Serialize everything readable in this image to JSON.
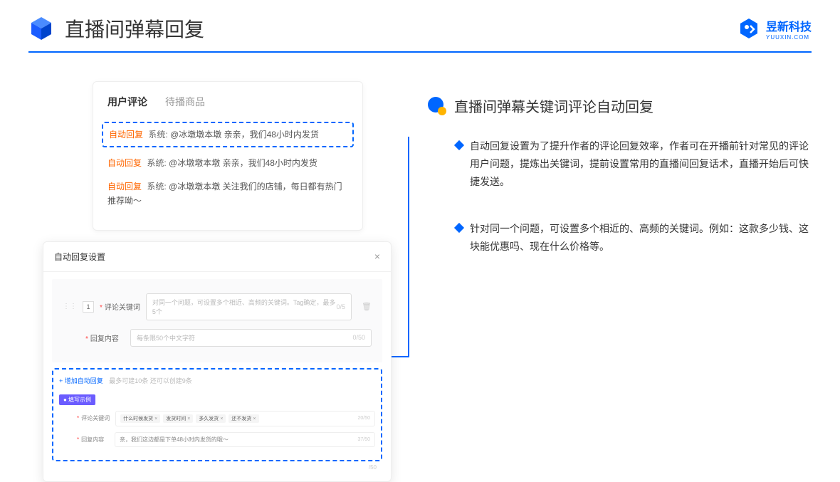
{
  "header": {
    "title": "直播间弹幕回复",
    "brand_cn": "昱新科技",
    "brand_en": "YUUXIN.COM"
  },
  "comments": {
    "tabs": [
      "用户评论",
      "待播商品"
    ],
    "active_tab": 0,
    "items": [
      {
        "label": "自动回复",
        "system": "系统:",
        "text": "@冰墩墩本墩 亲亲，我们48小时内发货"
      },
      {
        "label": "自动回复",
        "system": "系统:",
        "text": "@冰墩墩本墩 亲亲，我们48小时内发货"
      },
      {
        "label": "自动回复",
        "system": "系统:",
        "text": "@冰墩墩本墩 关注我们的店铺，每日都有热门推荐呦～"
      }
    ]
  },
  "settings": {
    "title": "自动回复设置",
    "row_num": "1",
    "keyword_label": "评论关键词",
    "keyword_placeholder": "对同一个问题，可设置多个相近、高频的关键词。Tag确定，最多5个",
    "keyword_counter": "0/5",
    "content_label": "回复内容",
    "content_placeholder": "每条限50个中文字符",
    "content_counter": "0/50",
    "add_link": "+ 增加自动回复",
    "add_hint": "最多可建10条 还可以创建9条",
    "example_badge": "● 填写示例",
    "example_keyword_label": "评论关键词",
    "example_tags": [
      "什么时候发货",
      "发货时间",
      "多久发货",
      "还不发货"
    ],
    "example_keyword_counter": "20/50",
    "example_content_label": "回复内容",
    "example_content_text": "亲，我们这边都是下单48小时内发货的哦～",
    "example_content_counter": "37/50",
    "bottom_counter": "/50"
  },
  "right": {
    "section_title": "直播间弹幕关键词评论自动回复",
    "bullets": [
      "自动回复设置为了提升作者的评论回复效率，作者可在开播前针对常见的评论用户问题，提炼出关键词，提前设置常用的直播间回复话术，直播开始后可快捷发送。",
      "针对同一个问题，可设置多个相近的、高频的关键词。例如：这款多少钱、这块能优惠吗、现在什么价格等。"
    ]
  }
}
